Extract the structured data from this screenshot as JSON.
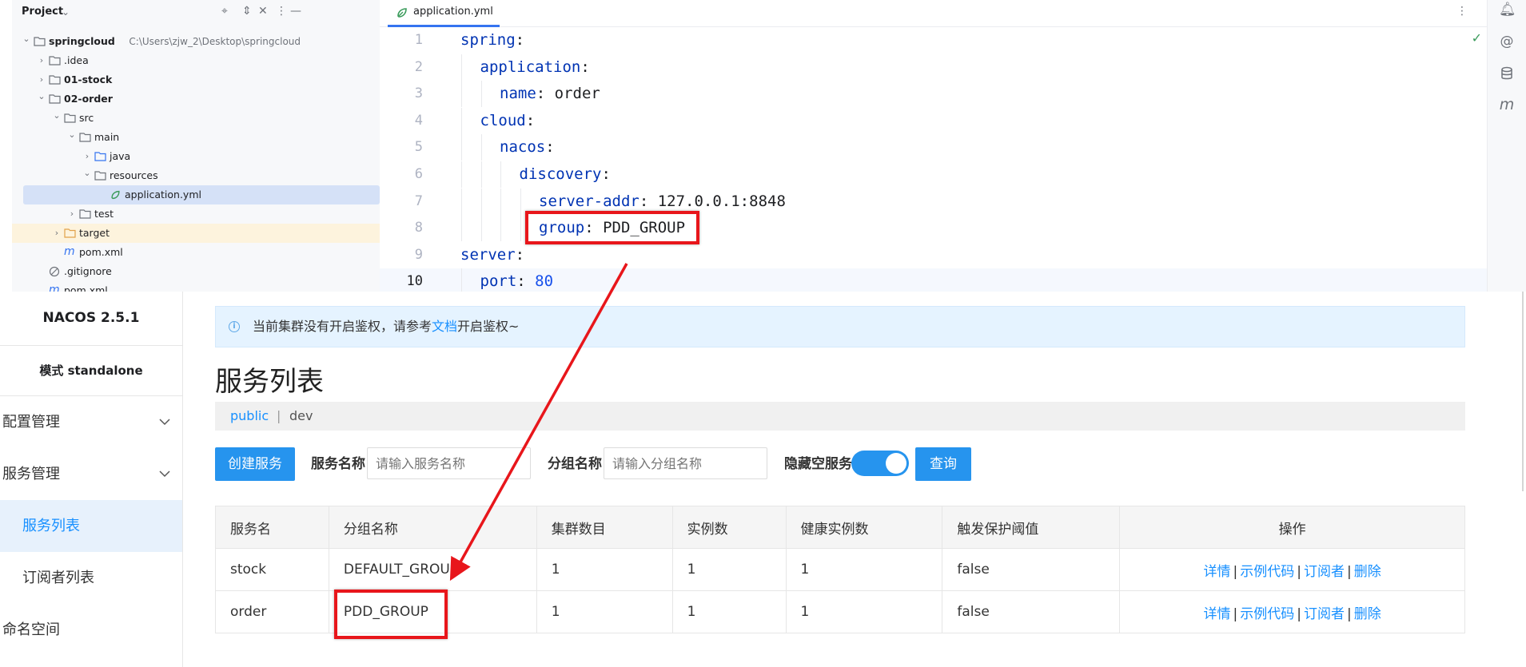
{
  "ide": {
    "project_panel": {
      "title": "Project",
      "icons": [
        "chevron-down-icon",
        "target-icon",
        "expand-icon",
        "collapse-icon",
        "more-icon",
        "minimize-icon"
      ],
      "tree": [
        {
          "label": "springcloud",
          "path": "C:\\Users\\zjw_2\\Desktop\\springcloud",
          "bold": true,
          "expanded": true,
          "icon": "module-folder-icon"
        },
        {
          "label": ".idea",
          "expanded": false,
          "icon": "folder-icon"
        },
        {
          "label": "01-stock",
          "bold": true,
          "expanded": false,
          "icon": "module-folder-icon"
        },
        {
          "label": "02-order",
          "bold": true,
          "expanded": true,
          "icon": "module-folder-icon"
        },
        {
          "label": "src",
          "expanded": true,
          "icon": "folder-icon"
        },
        {
          "label": "main",
          "expanded": true,
          "icon": "folder-icon"
        },
        {
          "label": "java",
          "expanded": false,
          "icon": "source-folder-icon"
        },
        {
          "label": "resources",
          "expanded": true,
          "icon": "resources-folder-icon"
        },
        {
          "label": "application.yml",
          "selected": true,
          "icon": "spring-yaml-icon"
        },
        {
          "label": "test",
          "expanded": false,
          "icon": "folder-icon"
        },
        {
          "label": "target",
          "expanded": false,
          "excluded": true,
          "icon": "excluded-folder-icon"
        },
        {
          "label": "pom.xml",
          "icon": "maven-icon"
        },
        {
          "label": ".gitignore",
          "icon": "ignore-icon"
        },
        {
          "label": "pom.xml",
          "icon": "maven-icon"
        }
      ]
    },
    "editor": {
      "tab": "application.yml",
      "lines": [
        {
          "no": "1",
          "key": "spring",
          "sep": ":",
          "value": ""
        },
        {
          "no": "2",
          "key": "application",
          "sep": ":",
          "value": ""
        },
        {
          "no": "3",
          "key": "name",
          "sep": ": ",
          "value": "order"
        },
        {
          "no": "4",
          "key": "cloud",
          "sep": ":",
          "value": ""
        },
        {
          "no": "5",
          "key": "nacos",
          "sep": ":",
          "value": ""
        },
        {
          "no": "6",
          "key": "discovery",
          "sep": ":",
          "value": ""
        },
        {
          "no": "7",
          "key": "server-addr",
          "sep": ": ",
          "value": "127.0.0.1:8848"
        },
        {
          "no": "8",
          "key": "group",
          "sep": ": ",
          "value": "PDD_GROUP"
        },
        {
          "no": "9",
          "key": "server",
          "sep": ":",
          "value": ""
        },
        {
          "no": "10",
          "key": "port",
          "sep": ": ",
          "value": "80"
        }
      ],
      "current_line": "10"
    },
    "right_toolbar_icons": [
      "notifications-icon",
      "ai-assistant-icon",
      "database-icon",
      "maven-icon"
    ]
  },
  "nacos": {
    "brand": "NACOS 2.5.1",
    "mode": "模式 standalone",
    "menu": [
      {
        "label": "配置管理",
        "chevron": true
      },
      {
        "label": "服务管理",
        "chevron": true
      },
      {
        "label": "服务列表",
        "sub": true,
        "active": true
      },
      {
        "label": "订阅者列表",
        "sub": true
      },
      {
        "label": "命名空间"
      }
    ],
    "notice": {
      "before": "当前集群没有开启鉴权，请参考",
      "link": "文档",
      "after": "开启鉴权~"
    },
    "page_title": "服务列表",
    "namespaces": {
      "public": "public",
      "separator": "|",
      "dev": "dev"
    },
    "toolbar": {
      "create_button": "创建服务",
      "service_name_label": "服务名称",
      "service_name_placeholder": "请输入服务名称",
      "group_name_label": "分组名称",
      "group_name_placeholder": "请输入分组名称",
      "hide_empty_label": "隐藏空服务",
      "hide_empty_on": true,
      "query_button": "查询"
    },
    "table": {
      "columns": [
        "服务名",
        "分组名称",
        "集群数目",
        "实例数",
        "健康实例数",
        "触发保护阈值",
        "操作"
      ],
      "rows": [
        [
          "stock",
          "DEFAULT_GROUP",
          "1",
          "1",
          "1",
          "false"
        ],
        [
          "order",
          "PDD_GROUP",
          "1",
          "1",
          "1",
          "false"
        ]
      ],
      "actions": [
        "详情",
        "示例代码",
        "订阅者",
        "删除"
      ],
      "action_separator": "|"
    }
  },
  "colors": {
    "annotation_red": "#e8161b",
    "nacos_blue": "#1890ff",
    "yaml_key": "#0033b3",
    "yaml_number": "#1750eb"
  }
}
